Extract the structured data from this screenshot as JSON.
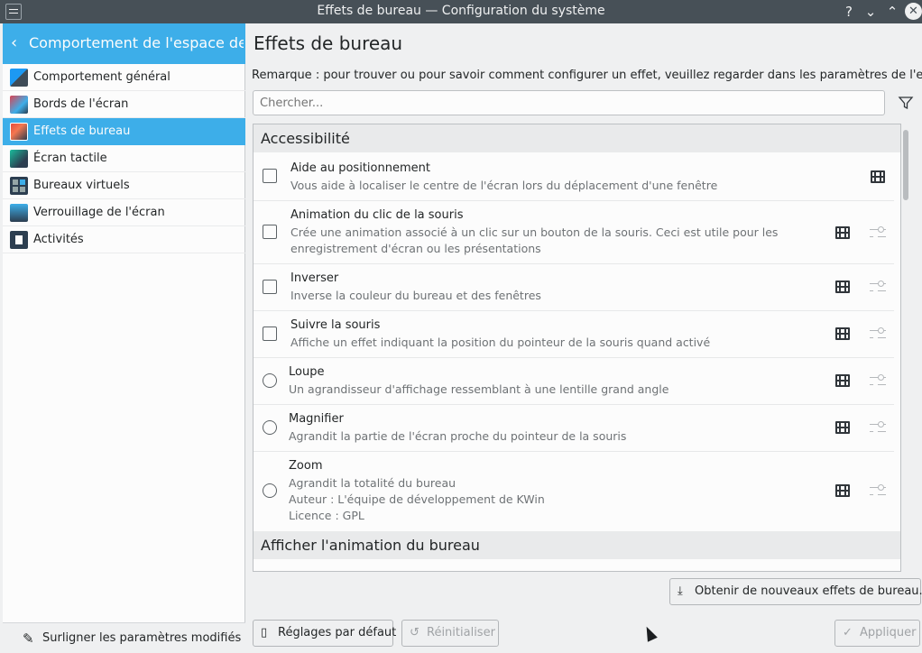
{
  "window": {
    "title": "Effets de bureau — Configuration du système",
    "help": "?",
    "minimize": "⌄",
    "maximize": "⌃",
    "close": "✕"
  },
  "sidebar": {
    "header": "Comportement de l'espace de...",
    "items": [
      {
        "label": "Comportement général",
        "icon": "general-behavior-icon"
      },
      {
        "label": "Bords de l'écran",
        "icon": "screen-edges-icon"
      },
      {
        "label": "Effets de bureau",
        "icon": "desktop-effects-icon",
        "active": true
      },
      {
        "label": "Écran tactile",
        "icon": "touch-screen-icon"
      },
      {
        "label": "Bureaux virtuels",
        "icon": "virtual-desktops-icon"
      },
      {
        "label": "Verrouillage de l'écran",
        "icon": "screen-lock-icon"
      },
      {
        "label": "Activités",
        "icon": "activities-icon"
      }
    ],
    "footer": "Surligner les paramètres modifiés"
  },
  "main": {
    "title": "Effets de bureau",
    "remark": "Remarque : pour trouver ou pour savoir comment configurer un effet, veuillez regarder dans les paramètres de l'effet.",
    "search_placeholder": "Chercher...",
    "sections": [
      {
        "title": "Accessibilité",
        "effects": [
          {
            "name": "Aide au positionnement",
            "desc": "Vous aide à localiser le centre de l'écran lors du déplacement d'une fenêtre",
            "control": "checkbox",
            "configurable": false
          },
          {
            "name": "Animation du clic de la souris",
            "desc": "Crée une animation associé à un clic sur un bouton de la souris. Ceci est utile pour les\nenregistrement d'écran ou les présentations",
            "control": "checkbox",
            "configurable": true
          },
          {
            "name": "Inverser",
            "desc": "Inverse la couleur du bureau et des fenêtres",
            "control": "checkbox",
            "configurable": true
          },
          {
            "name": "Suivre la souris",
            "desc": "Affiche un effet indiquant la position du pointeur de la souris quand activé",
            "control": "checkbox",
            "configurable": true
          },
          {
            "name": "Loupe",
            "desc": "Un agrandisseur d'affichage ressemblant à une lentille grand angle",
            "control": "radio",
            "configurable": true
          },
          {
            "name": "Magnifier",
            "desc": "Agrandit la partie de l'écran proche du pointeur de la souris",
            "control": "radio",
            "configurable": true
          },
          {
            "name": "Zoom",
            "desc": "Agrandit la totalité du bureau\nAuteur : L'équipe de développement de KWin\nLicence : GPL",
            "control": "radio",
            "configurable": true
          }
        ]
      },
      {
        "title": "Afficher l'animation du bureau",
        "effects": []
      }
    ],
    "buttons": {
      "get_new": "Obtenir de nouveaux effets de bureau...",
      "defaults": "Réglages par défaut",
      "reset": "Réinitialiser",
      "apply": "Appliquer"
    }
  }
}
